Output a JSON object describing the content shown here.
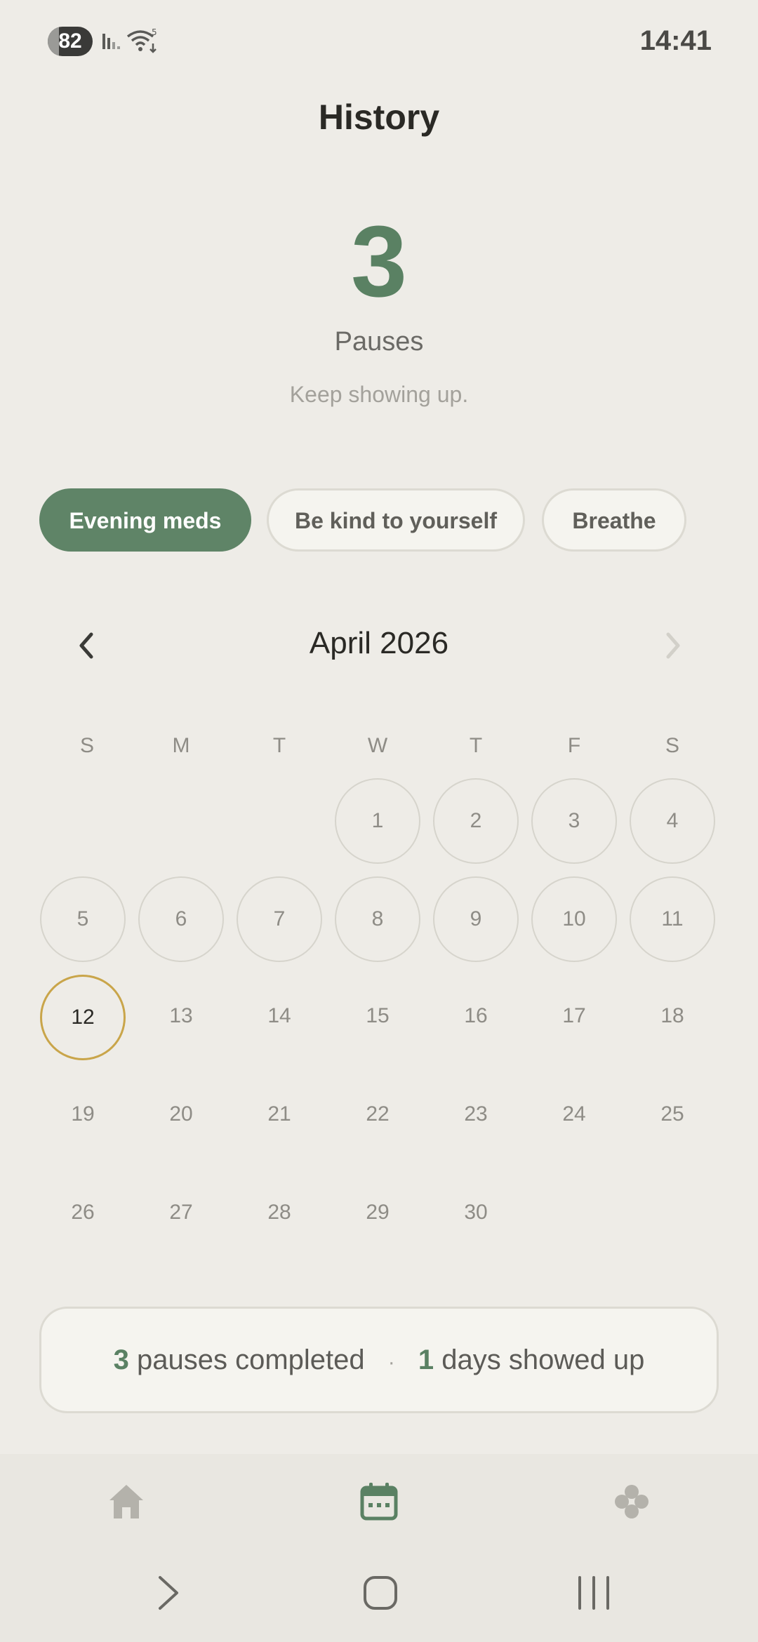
{
  "status_bar": {
    "battery": "82",
    "time": "14:41",
    "wifi_badge": "5"
  },
  "header": {
    "title": "History"
  },
  "summary_hero": {
    "count": "3",
    "label": "Pauses",
    "subtitle": "Keep showing up."
  },
  "chips": [
    {
      "label": "Evening meds",
      "active": true
    },
    {
      "label": "Be kind to yourself",
      "active": false
    },
    {
      "label": "Breathe",
      "active": false
    }
  ],
  "calendar": {
    "month_title": "April 2026",
    "weekdays": [
      "S",
      "M",
      "T",
      "W",
      "T",
      "F",
      "S"
    ],
    "days": [
      "1",
      "2",
      "3",
      "4",
      "5",
      "6",
      "7",
      "8",
      "9",
      "10",
      "11",
      "12",
      "13",
      "14",
      "15",
      "16",
      "17",
      "18",
      "19",
      "20",
      "21",
      "22",
      "23",
      "24",
      "25",
      "26",
      "27",
      "28",
      "29",
      "30"
    ],
    "first_weekday_index": 3,
    "today": "12"
  },
  "footer_summary": {
    "pauses_count": "3",
    "pauses_text": "pauses completed",
    "separator": "·",
    "days_count": "1",
    "days_text": "days showed up"
  },
  "colors": {
    "accent": "#5a8163",
    "today_ring": "#c9a54a",
    "background": "#eeece7"
  },
  "bottom_nav": {
    "items": [
      {
        "icon": "home-icon",
        "active": false
      },
      {
        "icon": "calendar-icon",
        "active": true
      },
      {
        "icon": "flower-icon",
        "active": false
      }
    ]
  }
}
